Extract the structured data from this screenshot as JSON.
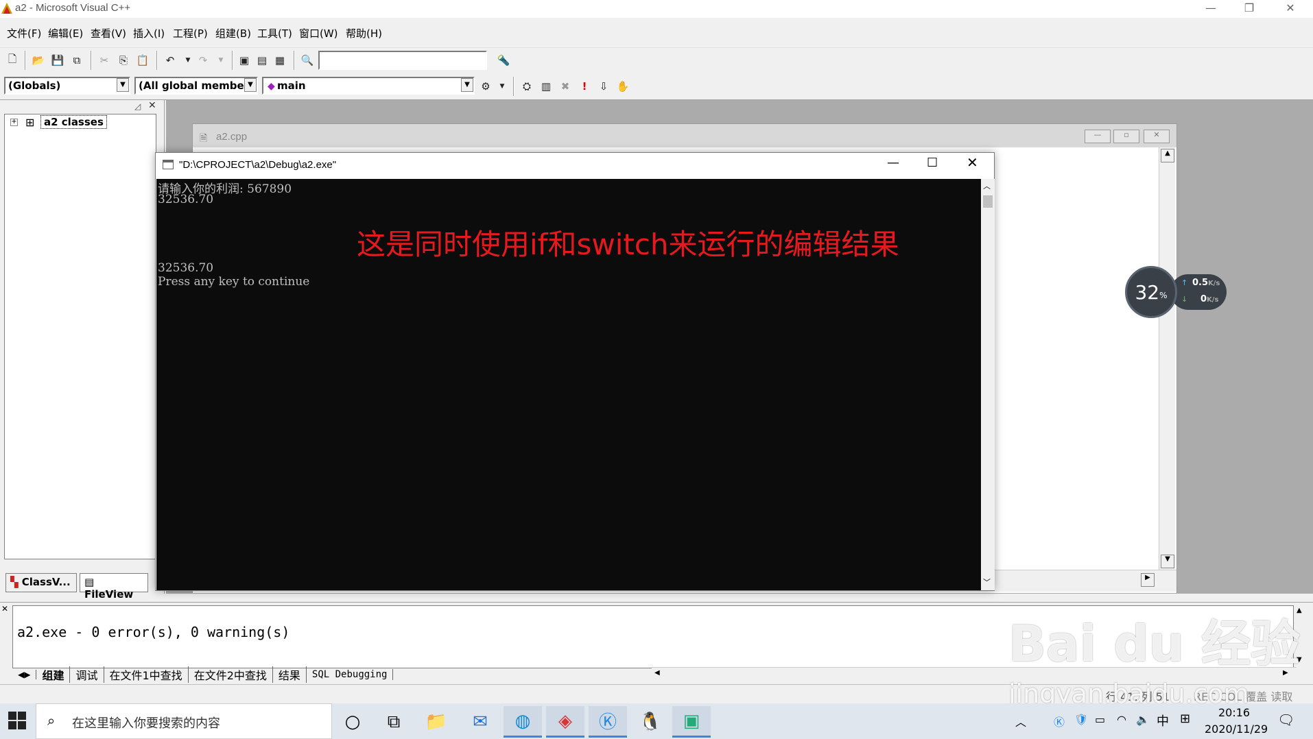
{
  "window": {
    "title": "a2 - Microsoft Visual C++",
    "minimize": "—",
    "restore": "❐",
    "close": "✕"
  },
  "menu": [
    "文件(F)",
    "编辑(E)",
    "查看(V)",
    "插入(I)",
    "工程(P)",
    "组建(B)",
    "工具(T)",
    "窗口(W)",
    "帮助(H)"
  ],
  "toolbar": {
    "find_combo_value": "",
    "scope_combo": "(Globals)",
    "members_combo": "(All global members",
    "function_combo": "main"
  },
  "workspace": {
    "tree_root": "a2 classes",
    "tab_classview": "ClassV...",
    "tab_fileview": "FileView"
  },
  "editor": {
    "title": "a2.cpp"
  },
  "console": {
    "title": "\"D:\\CPROJECT\\a2\\Debug\\a2.exe\"",
    "lines": [
      "请输入你的利润: 567890",
      "32536.70",
      "",
      "",
      "32536.70",
      "Press any key to continue"
    ],
    "overlay_note": "这是同时使用if和switch来运行的编辑结果"
  },
  "output": {
    "message": "a2.exe - 0 error(s), 0 warning(s)",
    "tabs": [
      "组建",
      "调试",
      "在文件1中查找",
      "在文件2中查找",
      "结果",
      "SQL Debugging"
    ]
  },
  "statusbar": {
    "position": "行 41, 列 51",
    "flags": "REC COL 覆盖 读取"
  },
  "netmon": {
    "percent": "32",
    "percent_unit": "%",
    "upload": "0.5",
    "download": "0",
    "unit": "K/s"
  },
  "taskbar": {
    "search_placeholder": "在这里输入你要搜索的内容",
    "ime": "中",
    "time": "20:16",
    "date": "2020/11/29"
  },
  "watermark": {
    "brand": "Bai du 经验",
    "url": "jingyan.baidu.com"
  }
}
